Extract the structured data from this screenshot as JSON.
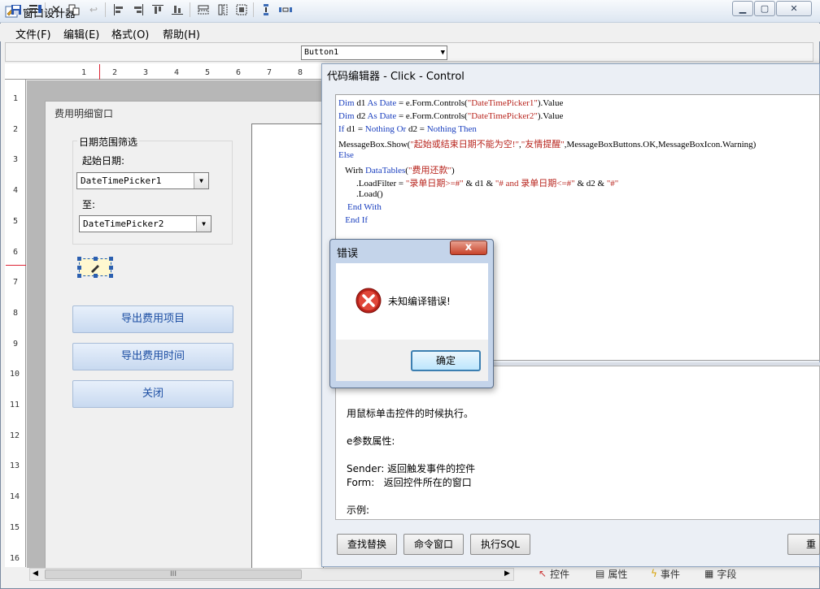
{
  "window": {
    "title": "窗口设计器"
  },
  "menu": [
    "文件(F)",
    "编辑(E)",
    "格式(O)",
    "帮助(H)"
  ],
  "toolbar": {
    "control_selected": "Button1"
  },
  "ruler_h": [
    "1",
    "2",
    "3",
    "4",
    "5",
    "6",
    "7",
    "8"
  ],
  "ruler_v": [
    "1",
    "2",
    "3",
    "4",
    "5",
    "6",
    "7",
    "8",
    "9",
    "10",
    "11",
    "12",
    "13",
    "14",
    "15",
    "16"
  ],
  "form": {
    "title": "费用明细窗口",
    "panel_title": "日期范围筛选",
    "start_label": "起始日期:",
    "dtp1": "DateTimePicker1",
    "to_label": "至:",
    "dtp2": "DateTimePicker2",
    "buttons": [
      "导出费用项目",
      "导出费用时间",
      "关闭"
    ]
  },
  "bottom_tabs": [
    "控件",
    "属性",
    "事件",
    "字段"
  ],
  "scroll_thumb": "III",
  "code_editor": {
    "title": "代码编辑器 - Click - Control",
    "lines": [
      [
        [
          "kw",
          "Dim "
        ],
        [
          "",
          "d1 "
        ],
        [
          "kw",
          "As "
        ],
        [
          "kw",
          "Date"
        ],
        [
          "",
          " = e.Form.Controls("
        ],
        [
          "str",
          "\"DateTimePicker1\""
        ],
        [
          "",
          ").Value"
        ]
      ],
      [
        [
          "kw",
          "Dim "
        ],
        [
          "",
          "d2 "
        ],
        [
          "kw",
          "As "
        ],
        [
          "kw",
          "Date"
        ],
        [
          "",
          " = e.Form.Controls("
        ],
        [
          "str",
          "\"DateTimePicker2\""
        ],
        [
          "",
          ").Value"
        ]
      ],
      [
        [
          "kw",
          "If "
        ],
        [
          "",
          "d1 = "
        ],
        [
          "kw",
          "Nothing "
        ],
        [
          "kw",
          "Or "
        ],
        [
          "",
          "d2 = "
        ],
        [
          "kw",
          "Nothing "
        ],
        [
          "kw",
          "Then"
        ]
      ],
      [
        [
          "",
          "MessageBox.Show("
        ],
        [
          "str",
          "\"起始或结束日期不能为空!\""
        ],
        [
          "",
          ","
        ],
        [
          "str",
          "\"友情提醒\""
        ],
        [
          "",
          ",MessageBoxButtons.OK,MessageBoxIcon.Warning)"
        ]
      ],
      [
        [
          "kw",
          "Else"
        ]
      ],
      [
        [
          "",
          "   Wirh "
        ],
        [
          "kw",
          "DataTables"
        ],
        [
          "",
          "("
        ],
        [
          "str",
          "\"费用还款\""
        ],
        [
          "",
          ")"
        ]
      ],
      [
        [
          "",
          "        .LoadFilter = "
        ],
        [
          "str",
          "\"录单日期>=#\""
        ],
        [
          "",
          " & d1 & "
        ],
        [
          "str",
          "\"# and 录单日期<=#\""
        ],
        [
          "",
          " & d2 & "
        ],
        [
          "str",
          "\"#\""
        ]
      ],
      [
        [
          "",
          "        .Load()"
        ]
      ],
      [
        [
          "kw",
          "    End With"
        ]
      ],
      [
        [
          "kw",
          "   End If"
        ]
      ]
    ],
    "help_lines": [
      "用鼠标单击控件的时候执行。",
      "",
      "e参数属性:",
      "",
      "Sender: 返回触发事件的控件",
      "Form:   返回控件所在的窗口",
      "",
      "示例:"
    ],
    "buttons": [
      "查找替换",
      "命令窗口",
      "执行SQL",
      "重登"
    ]
  },
  "error_dialog": {
    "title": "错误",
    "message": "未知编译错误!",
    "ok_label": "确定",
    "close_glyph": "x"
  }
}
